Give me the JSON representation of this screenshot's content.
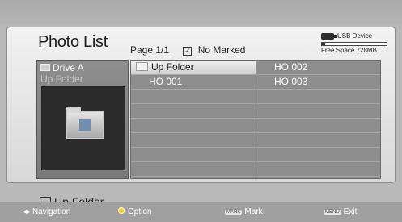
{
  "title": "Photo List",
  "header": {
    "page": "Page 1/1",
    "marked": "No Marked"
  },
  "usb": {
    "label": "USB Device",
    "free": "Free Space 728MB",
    "used_fraction": 0.05
  },
  "drive": {
    "name": "Drive A",
    "path": "Up Folder"
  },
  "up_folder_label": "Up Folder",
  "files": {
    "row1": {
      "left": "Up Folder",
      "right": "HO 002"
    },
    "row2": {
      "left": "HO 001",
      "right": "HO 003"
    }
  },
  "footer": {
    "navigation": "Navigation",
    "option": "Option",
    "mark_key": "MARK",
    "mark": "Mark",
    "menu_key": "MENU",
    "exit": "Exit"
  },
  "colors": {
    "selection": "#e8e8e8",
    "grid": "#8d8d8d",
    "option_dot": "#ffd400"
  }
}
